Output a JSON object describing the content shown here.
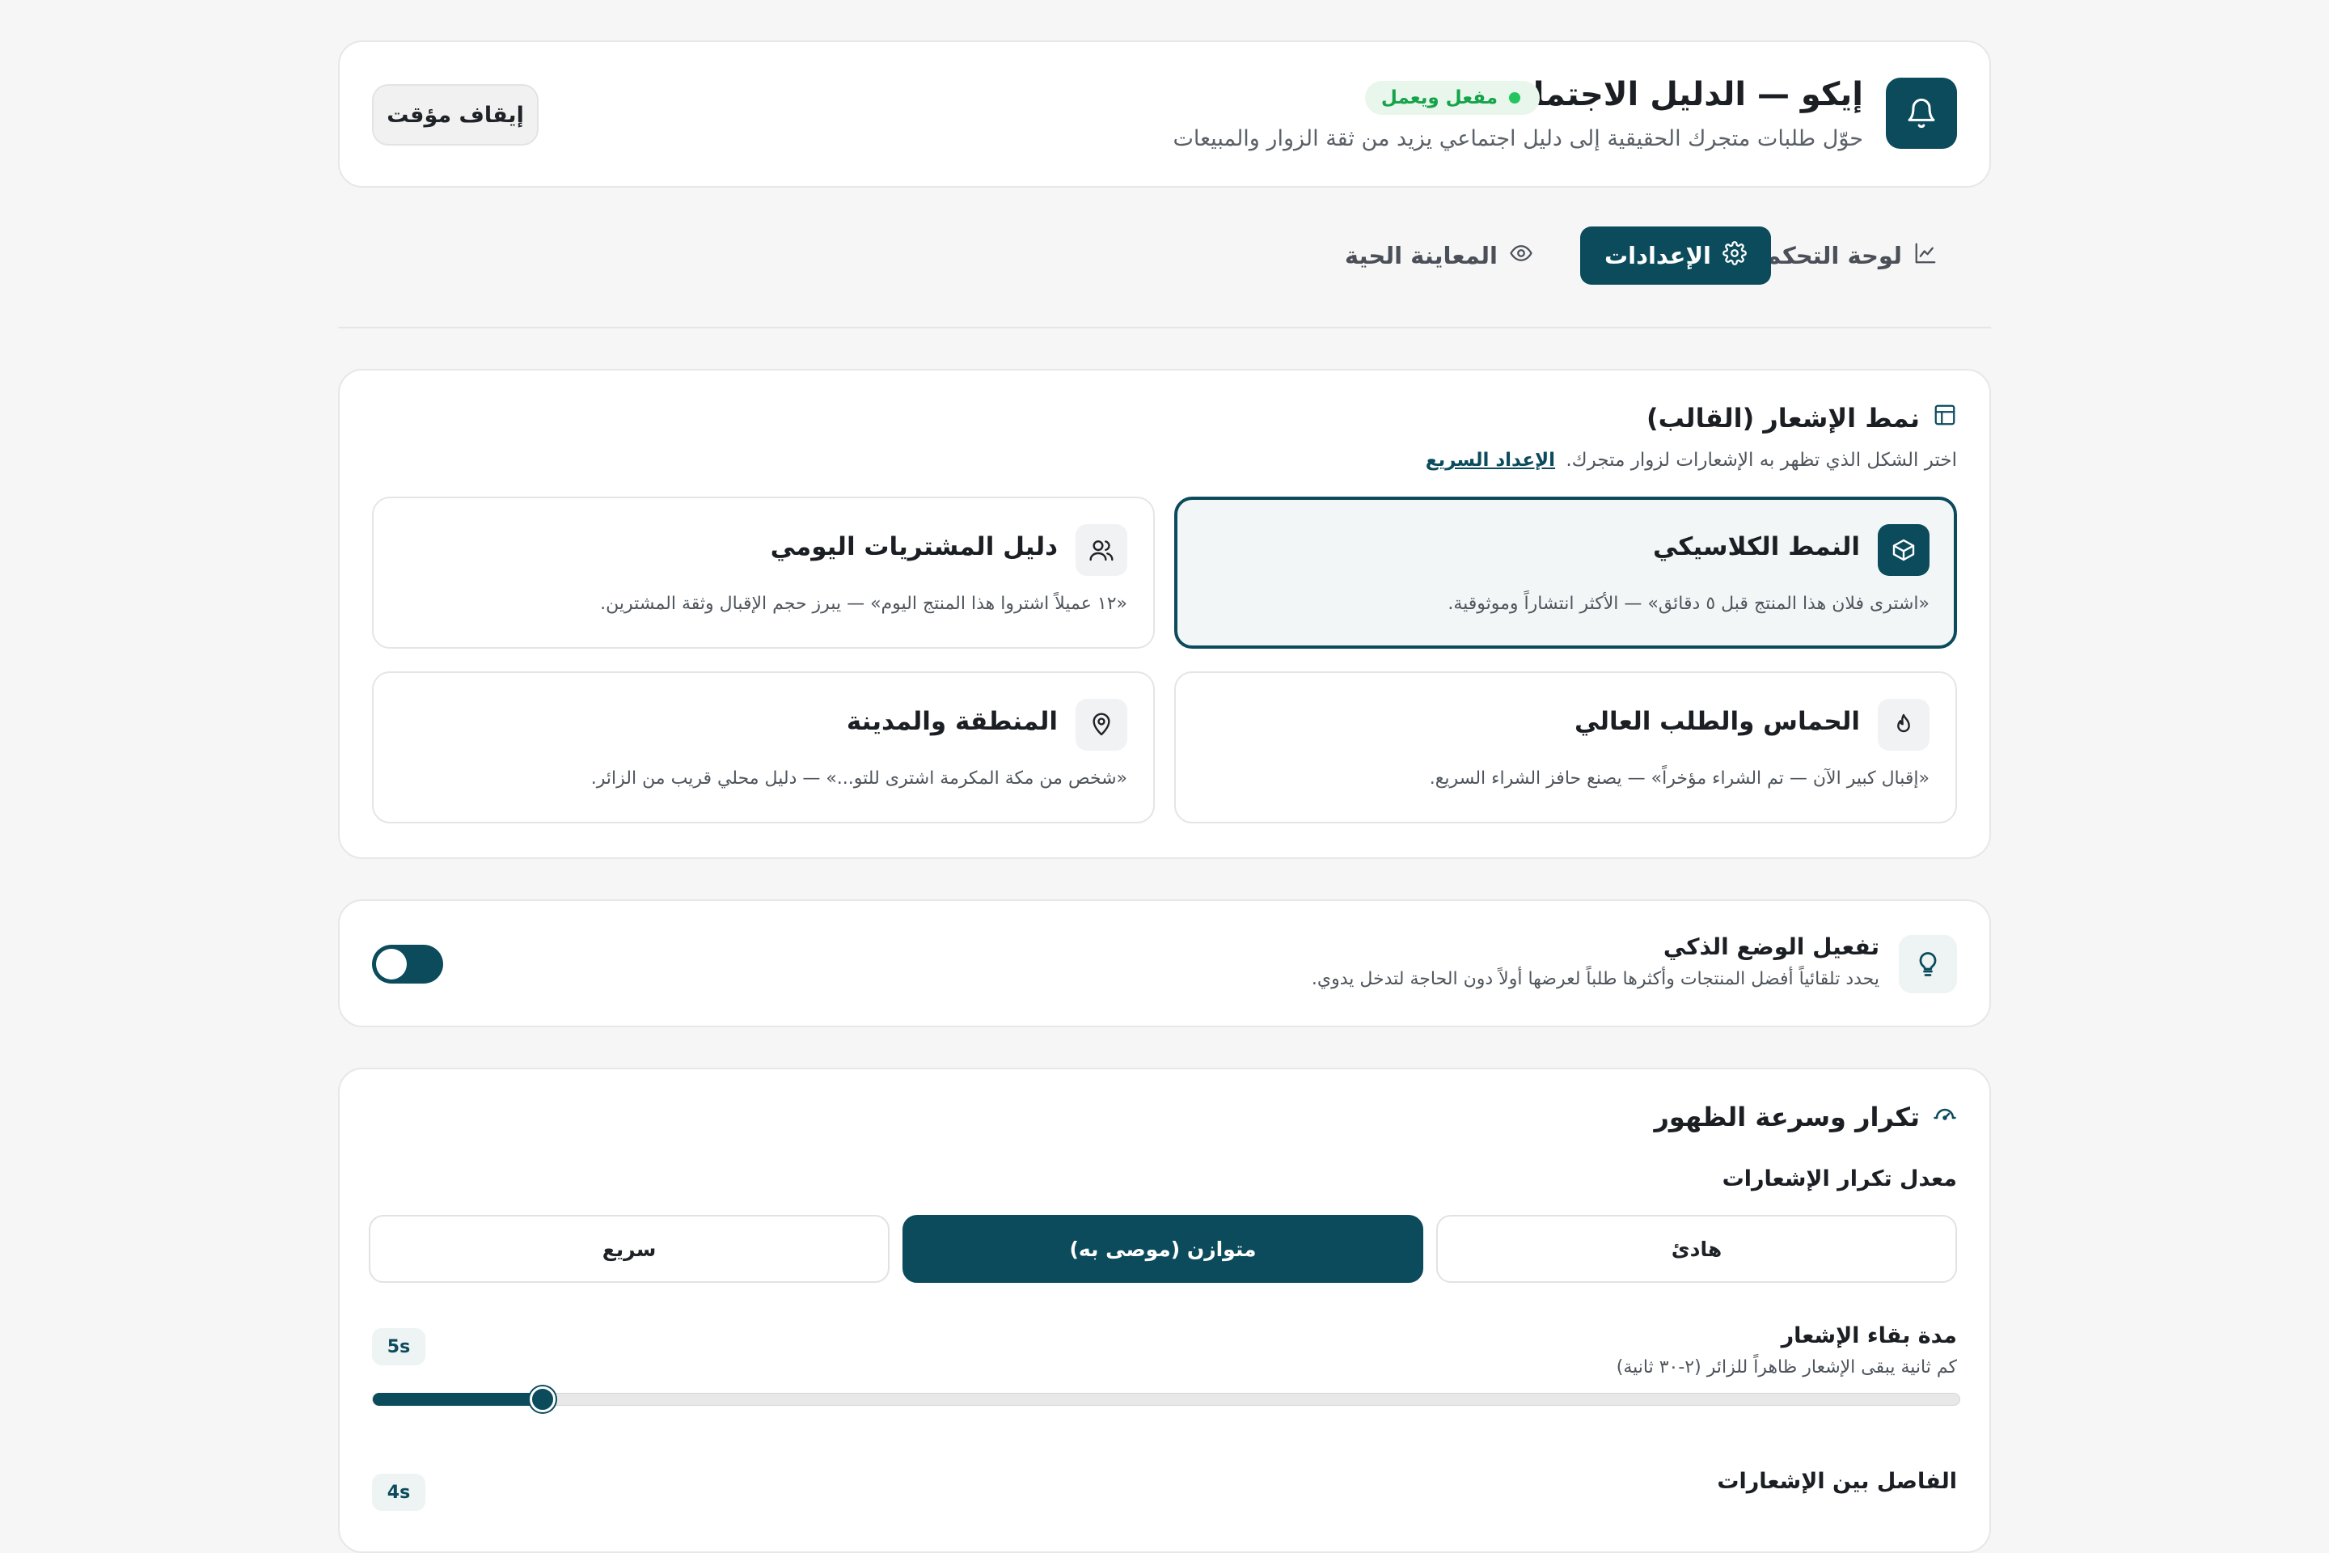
{
  "header": {
    "title": "إيكو — الدليل الاجتماعي",
    "status_badge": "مفعل ويعمل",
    "subtitle": "حوّل طلبات متجرك الحقيقية إلى دليل اجتماعي يزيد من ثقة الزوار والمبيعات",
    "pause_label": "إيقاف مؤقت",
    "icon": "bell-icon"
  },
  "tabs": [
    {
      "label": "لوحة التحكم",
      "icon": "chart-line-icon",
      "active": false
    },
    {
      "label": "الإعدادات",
      "icon": "gear-icon",
      "active": true
    },
    {
      "label": "المعاينة الحية",
      "icon": "eye-icon",
      "active": false
    }
  ],
  "template_section": {
    "title": "نمط الإشعار (القالب)",
    "description": "اختر الشكل الذي تظهر به الإشعارات لزوار متجرك.",
    "quick_setup_link": "الإعداد السريع",
    "options": [
      {
        "title": "النمط الكلاسيكي",
        "description": "«اشترى فلان هذا المنتج قبل ٥ دقائق» — الأكثر انتشاراً وموثوقية.",
        "icon": "box-icon",
        "selected": true
      },
      {
        "title": "دليل المشتريات اليومي",
        "description": "«١٢ عميلاً اشتروا هذا المنتج اليوم» — يبرز حجم الإقبال وثقة المشترين.",
        "icon": "users-icon",
        "selected": false
      },
      {
        "title": "الحماس والطلب العالي",
        "description": "«إقبال كبير الآن — تم الشراء مؤخراً» — يصنع حافز الشراء السريع.",
        "icon": "flame-icon",
        "selected": false
      },
      {
        "title": "المنطقة والمدينة",
        "description": "«شخص من مكة المكرمة اشترى للتو...» — دليل محلي قريب من الزائر.",
        "icon": "map-pin-icon",
        "selected": false
      }
    ]
  },
  "smart_mode": {
    "title": "تفعيل الوضع الذكي",
    "subtitle": "يحدد تلقائياً أفضل المنتجات وأكثرها طلباً لعرضها أولاً دون الحاجة لتدخل يدوي.",
    "icon": "lightbulb-icon",
    "enabled": true
  },
  "frequency_section": {
    "title": "تكرار وسرعة الظهور",
    "icon": "gauge-icon",
    "rate_label": "معدل تكرار الإشعارات",
    "rate_options": [
      {
        "label": "هادئ",
        "active": false
      },
      {
        "label": "متوازن (موصى به)",
        "active": true
      },
      {
        "label": "سريع",
        "active": false
      }
    ],
    "duration_label": "مدة بقاء الإشعار",
    "duration_sub": "كم ثانية يبقى الإشعار ظاهراً للزائر (٢-٣٠ ثانية)",
    "duration_value": "5s",
    "duration_seconds": 5,
    "duration_min": 2,
    "duration_max": 30,
    "interval_label": "الفاصل بين الإشعارات",
    "interval_value": "4s"
  },
  "colors": {
    "primary": "#0b4b5c",
    "status_green": "#16a34a",
    "background": "#f6f6f6"
  }
}
